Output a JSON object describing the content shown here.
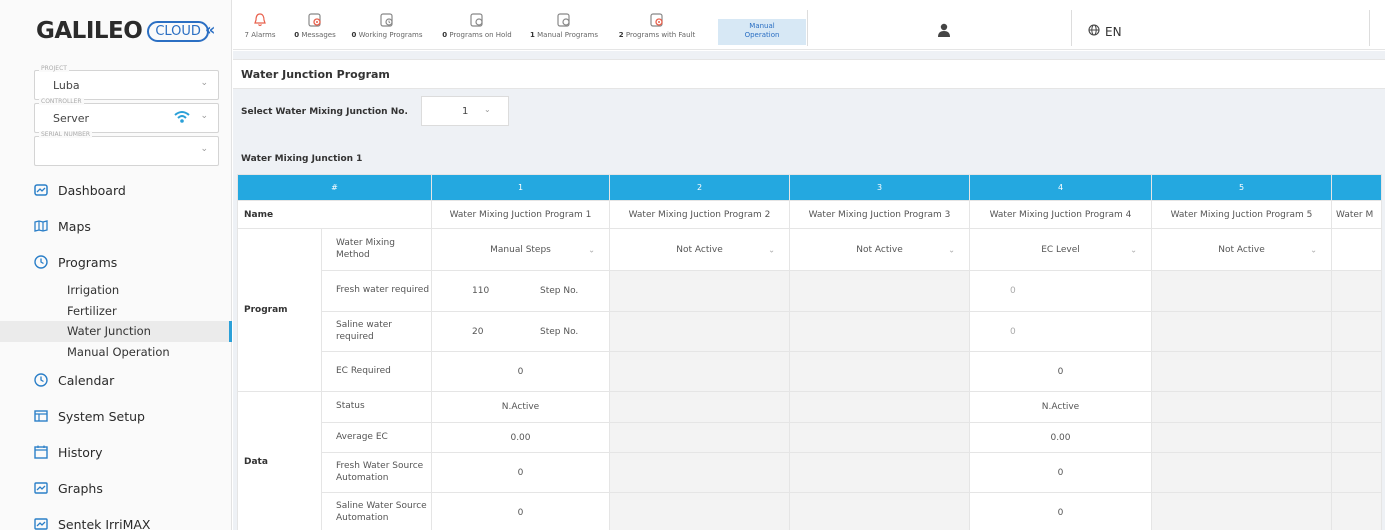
{
  "sidebar": {
    "logo_main": "GALILEO",
    "logo_cloud": "CLOUD",
    "collapse": "«",
    "project": {
      "label": "PROJECT",
      "value": "Luba"
    },
    "controller": {
      "label": "CONTROLLER",
      "value": "Server"
    },
    "serial": {
      "label": "SERIAL NUMBER",
      "value": ""
    },
    "nav": {
      "dashboard": "Dashboard",
      "maps": "Maps",
      "programs": "Programs",
      "irrigation": "Irrigation",
      "fertilizer": "Fertilizer",
      "water_junction": "Water Junction",
      "manual_operation": "Manual Operation",
      "calendar": "Calendar",
      "system_setup": "System Setup",
      "history": "History",
      "graphs": "Graphs",
      "sentek": "Sentek IrriMAX"
    }
  },
  "topbar": {
    "alarms": {
      "count": "7",
      "label": "Alarms"
    },
    "messages": {
      "count": "0",
      "label": "Messages"
    },
    "working": {
      "count": "0",
      "label": "Working Programs"
    },
    "on_hold": {
      "count": "0",
      "label": "Programs on Hold"
    },
    "manual_programs": {
      "count": "1",
      "label": "Manual Programs"
    },
    "fault": {
      "count": "2",
      "label": "Programs with Fault"
    },
    "manual_operation": {
      "line1": "Manual",
      "line2": "Operation"
    },
    "language": "EN"
  },
  "main": {
    "page_title": "Water Junction Program",
    "select_label": "Select Water Mixing Junction No.",
    "select_value": "1",
    "section_title": "Water Mixing Junction 1",
    "table": {
      "hash": "#",
      "columns": [
        "1",
        "2",
        "3",
        "4",
        "5"
      ],
      "name_label": "Name",
      "names": [
        "Water Mixing Juction Program 1",
        "Water Mixing Juction Program 2",
        "Water Mixing Juction Program 3",
        "Water Mixing Juction Program 4",
        "Water Mixing Juction Program 5",
        "Water M"
      ],
      "program_label": "Program",
      "method_label": "Water Mixing Method",
      "methods": [
        "Manual Steps",
        "Not Active",
        "Not Active",
        "EC Level",
        "Not Active"
      ],
      "fresh_label": "Fresh water required",
      "fresh": {
        "p1_value": "110",
        "p1_unit": "Step No.",
        "p4_value": "0"
      },
      "saline_label": "Saline water required",
      "saline": {
        "p1_value": "20",
        "p1_unit": "Step No.",
        "p4_value": "0"
      },
      "ec_label": "EC Required",
      "ec": {
        "p1": "0",
        "p4": "0"
      },
      "data_label": "Data",
      "status_label": "Status",
      "status": {
        "p1": "N.Active",
        "p4": "N.Active"
      },
      "avg_ec_label": "Average EC",
      "avg_ec": {
        "p1": "0.00",
        "p4": "0.00"
      },
      "fresh_src_label": "Fresh Water Source Automation",
      "fresh_src": {
        "p1": "0",
        "p4": "0"
      },
      "saline_src_label": "Saline Water Source Automation",
      "saline_src": {
        "p1": "0",
        "p4": "0"
      }
    }
  },
  "colors": {
    "accent": "#24a8e0",
    "brand": "#2b6fc3",
    "alarm": "#e8604c"
  }
}
